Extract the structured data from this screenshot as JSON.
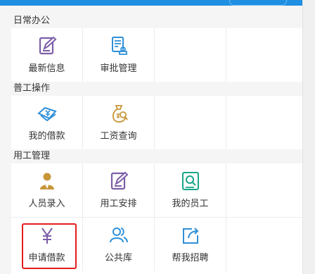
{
  "sections": [
    {
      "title": "日常办公",
      "items": [
        {
          "label": "最新信息",
          "icon": "edit-note-icon"
        },
        {
          "label": "审批管理",
          "icon": "approval-document-icon"
        }
      ]
    },
    {
      "title": "普工操作",
      "items": [
        {
          "label": "我的借款",
          "icon": "loan-cash-icon"
        },
        {
          "label": "工资查询",
          "icon": "salary-bag-search-icon"
        }
      ]
    },
    {
      "title": "用工管理",
      "items": [
        {
          "label": "人员录入",
          "icon": "person-icon"
        },
        {
          "label": "用工安排",
          "icon": "edit-note-icon"
        },
        {
          "label": "我的员工",
          "icon": "search-employee-icon"
        },
        {
          "label": "申请借款",
          "icon": "yen-icon"
        },
        {
          "label": "公共库",
          "icon": "users-icon"
        },
        {
          "label": "帮我招聘",
          "icon": "share-icon"
        }
      ]
    }
  ],
  "colors": {
    "purple": "#7b5ea7",
    "blue": "#2f8fd8",
    "gold": "#c7963a",
    "teal": "#1aa58a",
    "highlight": "#e31c1c"
  }
}
